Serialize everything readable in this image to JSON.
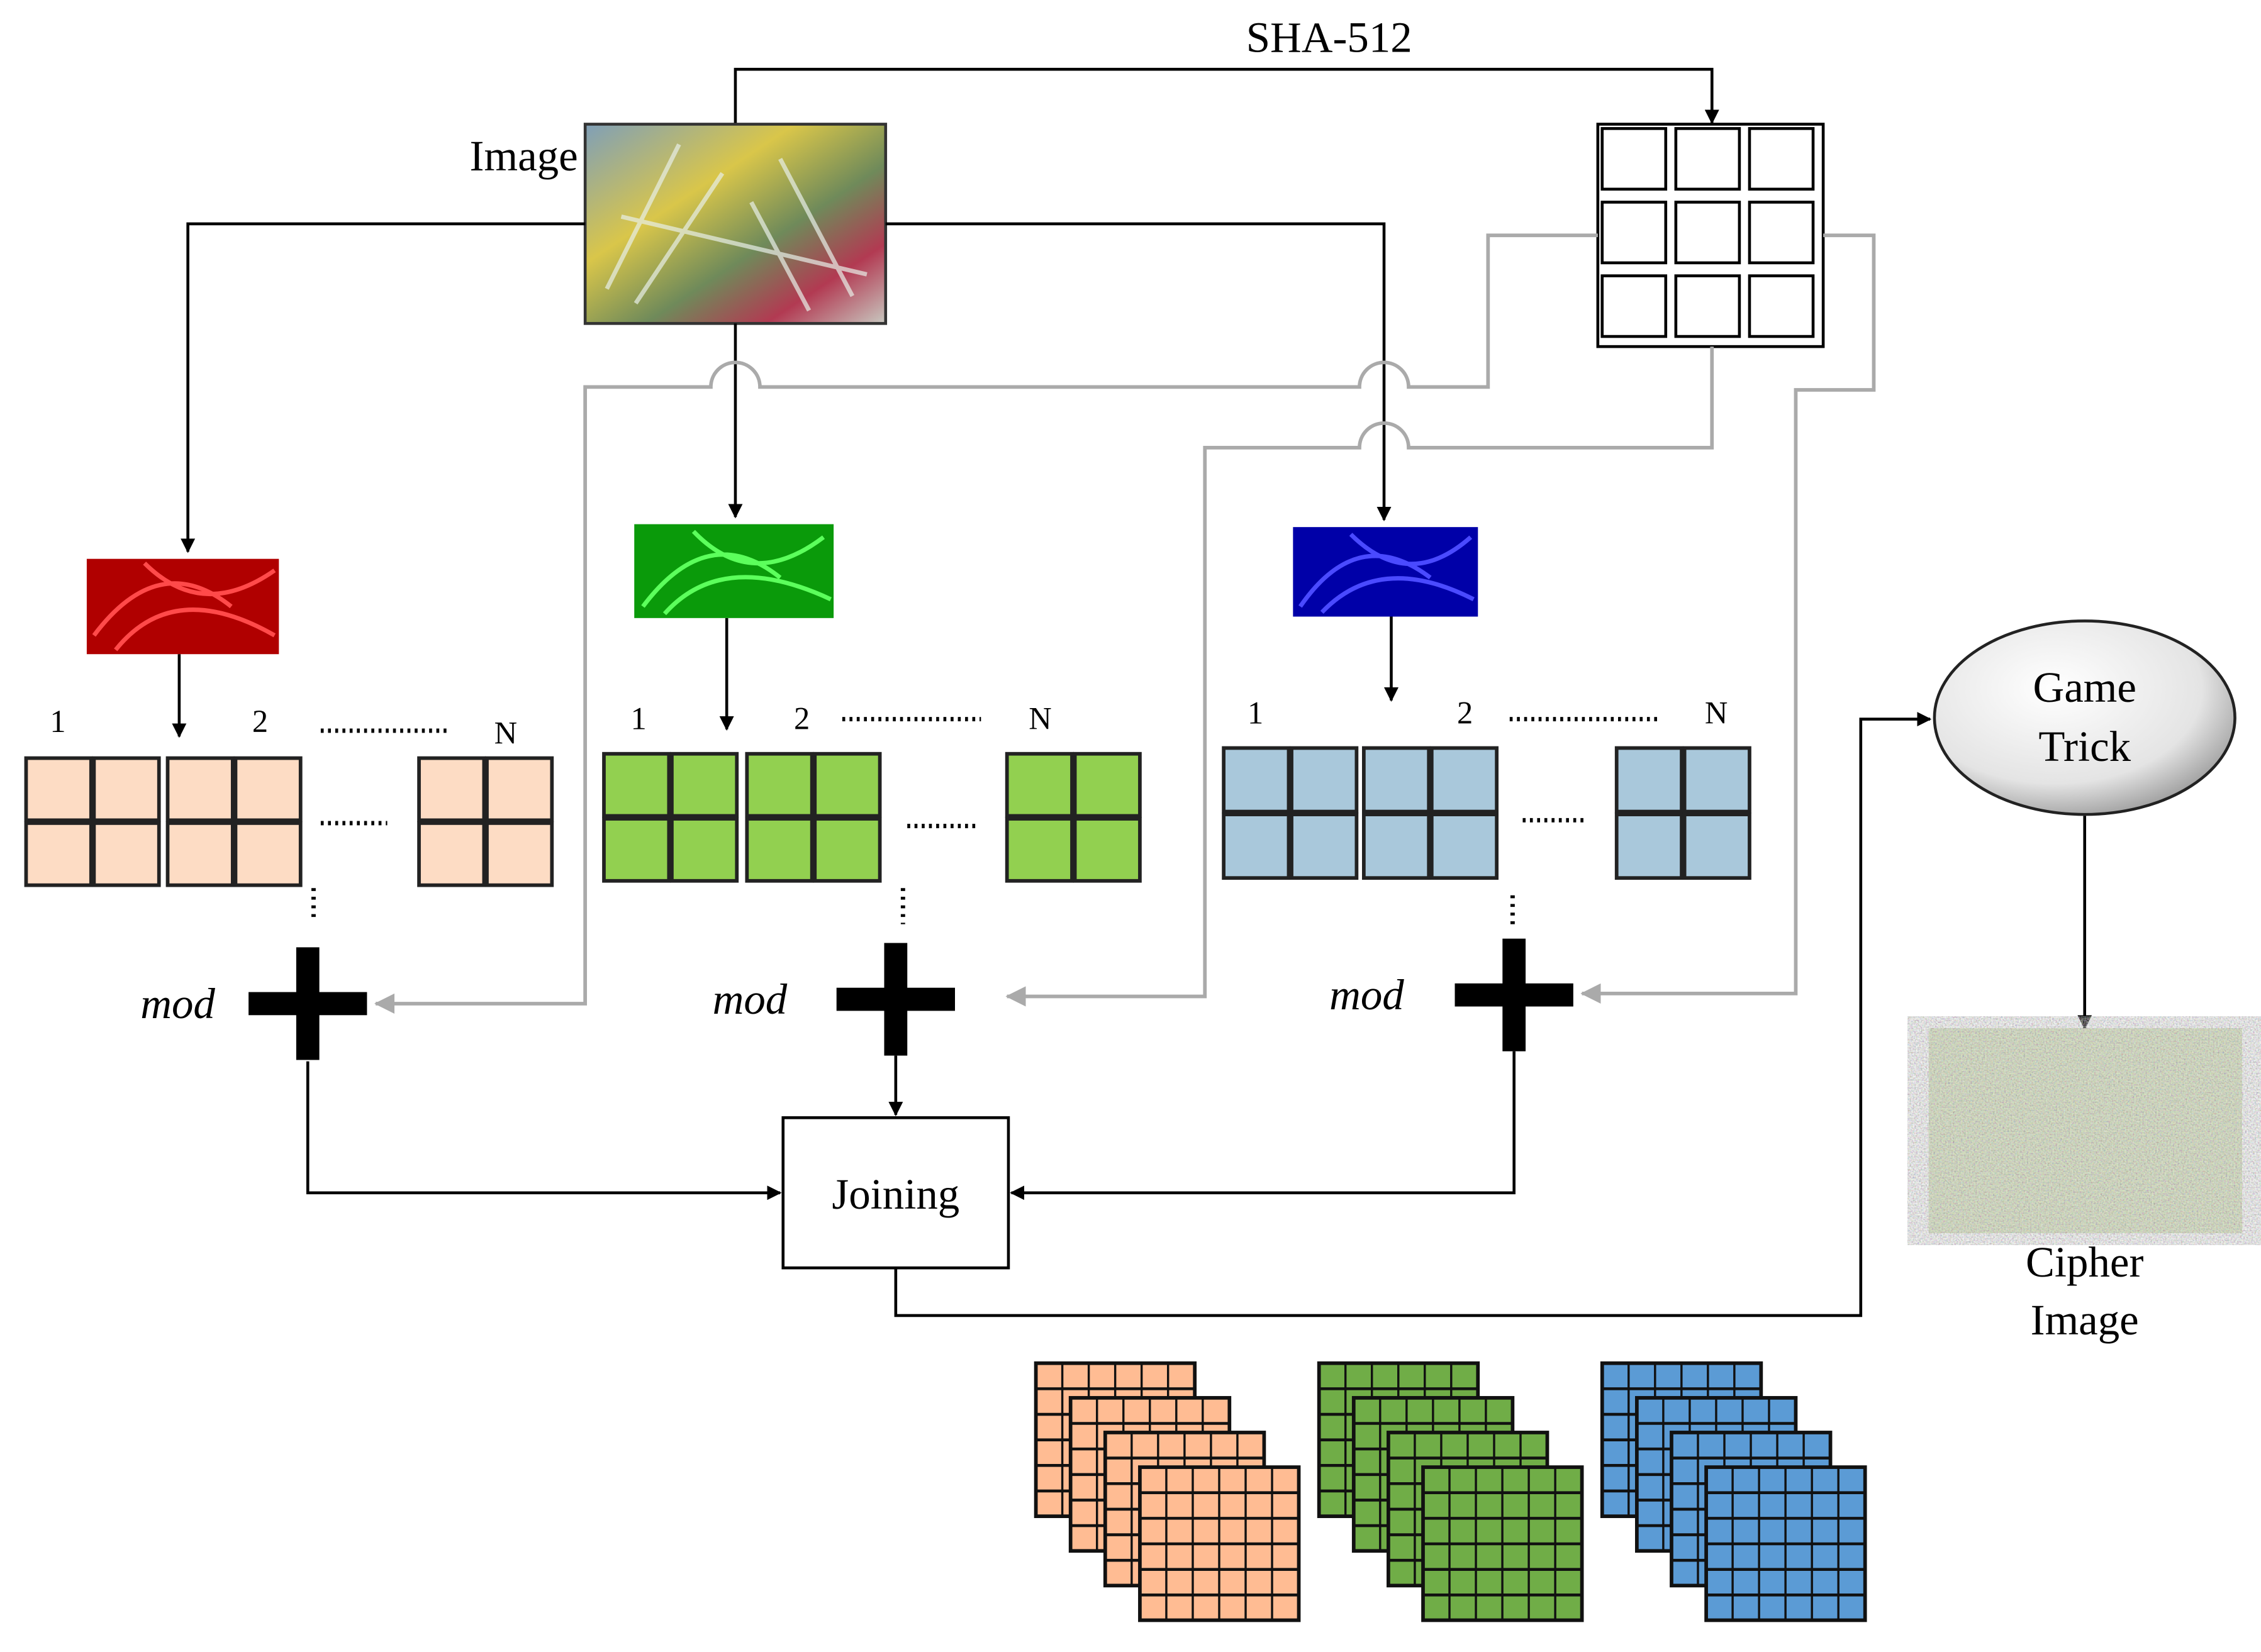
{
  "hash": {
    "label": "SHA-512"
  },
  "input": {
    "label": "Image"
  },
  "channels": [
    {
      "name": "red",
      "color": "#d01010",
      "block_fill": "#fddcc4",
      "labels": [
        "1",
        "2",
        "N"
      ]
    },
    {
      "name": "green",
      "color": "#1fb21f",
      "block_fill": "#92d050",
      "labels": [
        "1",
        "2",
        "N"
      ]
    },
    {
      "name": "blue",
      "color": "#1010b0",
      "block_fill": "#a9c8db",
      "labels": [
        "1",
        "2",
        "N"
      ]
    }
  ],
  "operation": {
    "label": "mod"
  },
  "joining": {
    "label": "Joining"
  },
  "game_trick": {
    "line1": "Game",
    "line2": "Trick"
  },
  "output": {
    "line1": "Cipher",
    "line2": "Image"
  },
  "stacks": {
    "colors": [
      "#ffbc93",
      "#70ad47",
      "#5b9bd5"
    ]
  },
  "colors": {
    "line": "#000000",
    "key_line": "#aaaaaa"
  }
}
